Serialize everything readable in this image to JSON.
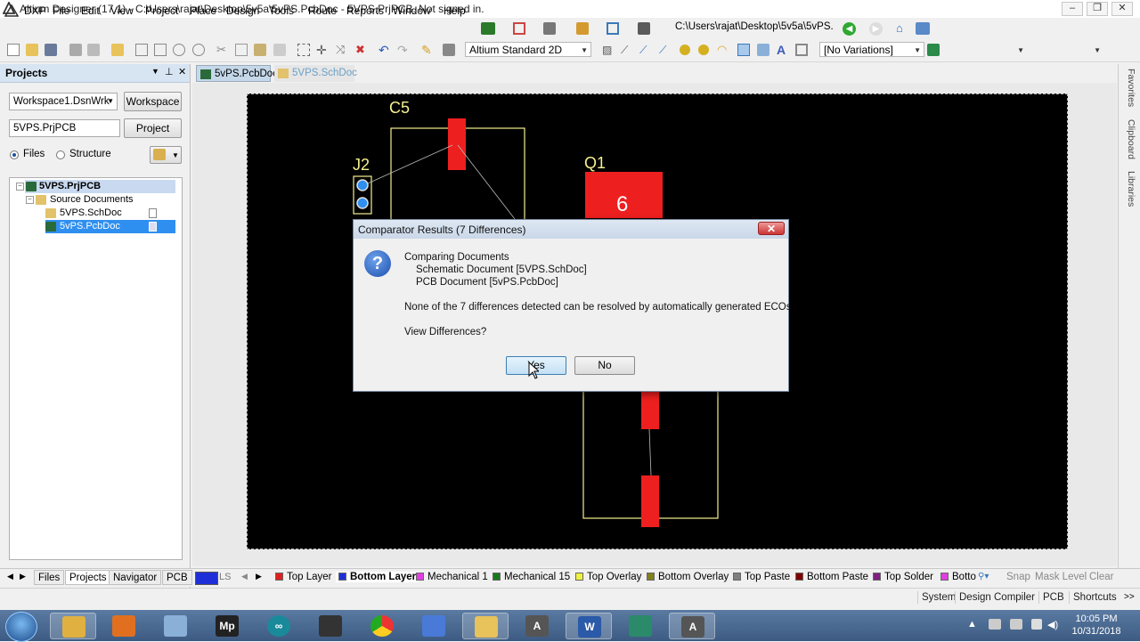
{
  "window": {
    "title": "Altium Designer (17.1) - C:\\Users\\rajat\\Desktop\\5v5a\\5vPS.PcbDoc - 5VPS.PrjPCB. Not signed in."
  },
  "menu": [
    "DXP",
    "File",
    "Edit",
    "View",
    "Project",
    "Place",
    "Design",
    "Tools",
    "Route",
    "Reports",
    "Window",
    "Help"
  ],
  "path_combo": "C:\\Users\\rajat\\Desktop\\5v5a\\5vPS.",
  "toolbar": {
    "view_mode": "Altium Standard 2D",
    "variations": "[No Variations]"
  },
  "projects_panel": {
    "title": "Projects",
    "workspace_value": "Workspace1.DsnWrk",
    "workspace_button": "Workspace",
    "project_value": "5VPS.PrjPCB",
    "project_button": "Project",
    "radio_files": "Files",
    "radio_structure": "Structure",
    "tree": {
      "root": "5VPS.PrjPCB",
      "folder": "Source Documents",
      "items": [
        "5VPS.SchDoc",
        "5vPS.PcbDoc"
      ]
    },
    "bottom_tabs": [
      "Files",
      "Projects",
      "Navigator",
      "PCB"
    ]
  },
  "doc_tabs": [
    "5vPS.PcbDoc",
    "5VPS.SchDoc"
  ],
  "canvas": {
    "designators": [
      "C5",
      "J2",
      "Q1"
    ],
    "pad_label": "6"
  },
  "side_tabs": [
    "Favorites",
    "Clipboard",
    "Libraries"
  ],
  "layers": {
    "ls_label": "LS",
    "items": [
      {
        "name": "Top Layer",
        "color": "#e02020"
      },
      {
        "name": "Bottom Layer",
        "color": "#1f2fd8"
      },
      {
        "name": "Mechanical 1",
        "color": "#e040e0"
      },
      {
        "name": "Mechanical 15",
        "color": "#1a7a1a"
      },
      {
        "name": "Top Overlay",
        "color": "#f0f040"
      },
      {
        "name": "Bottom Overlay",
        "color": "#808020"
      },
      {
        "name": "Top Paste",
        "color": "#808080"
      },
      {
        "name": "Bottom Paste",
        "color": "#800000"
      },
      {
        "name": "Top Solder",
        "color": "#802080"
      },
      {
        "name": "Botto",
        "color": "#e040e0"
      }
    ],
    "right_buttons": [
      "Snap",
      "Mask Level",
      "Clear"
    ]
  },
  "status_bar": [
    "System",
    "Design Compiler",
    "PCB",
    "Shortcuts"
  ],
  "dialog": {
    "title": "Comparator Results (7 Differences)",
    "line1": "Comparing Documents",
    "line2": "Schematic Document [5VPS.SchDoc]",
    "line3": "PCB Document [5vPS.PcbDoc]",
    "line4": "None of the 7 differences detected can be resolved by automatically generated ECOs",
    "line5": "View Differences?",
    "yes": "Yes",
    "no": "No"
  },
  "clock": {
    "time": "10:05 PM",
    "date": "10/31/2018"
  },
  "colors": {
    "pcb_background": "#000000",
    "pad_red": "#ee1f1f",
    "overlay_yellow": "#f5f090",
    "selection_blue": "#2f8ff0"
  }
}
